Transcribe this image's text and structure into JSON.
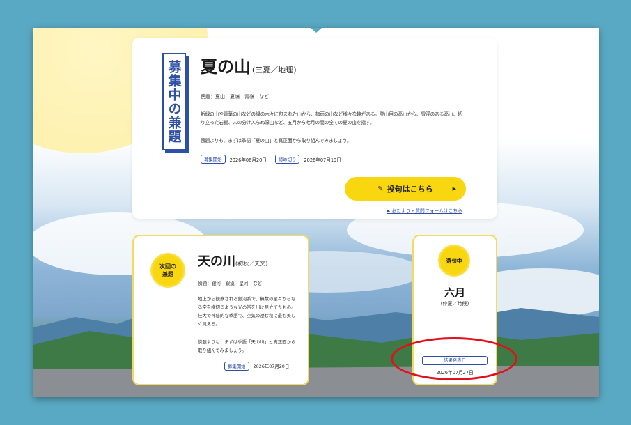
{
  "main": {
    "vertical_label": "募集中の兼題",
    "title": "夏の山",
    "subtitle": "(三夏／地理)",
    "side_names": "傍題：夏山　夏嶺　青嶺　など",
    "description": "新緑の山や青葉の山などの緑の木々に包まれた山から、梅雨の山など様々な趣がある。登山用の高山から、雪渓のある高山、切り立った岩棚、人の分け入らぬ深山など、五月から七月の間の全ての夏の山を指す。",
    "description2": "傍題よりも、まずは季語「夏の山」と真正面から取り組んでみましょう。",
    "start_label": "募集開始",
    "start_date": "2026年06月20日",
    "end_label": "締め切り",
    "end_date": "2026年07月19日",
    "post_button": "投句はこちら",
    "letter_link": "▶ おたより・質問フォームはこちら"
  },
  "next": {
    "badge": "次回の兼題",
    "title": "天の川",
    "subtitle": "(初秋／天文)",
    "side_names": "傍題：銀河　銀漢　星河　など",
    "description": "地上から観察される銀河系で、無数の星々からなる空を横切るような光の帯を川に見立てたもの。壮大で神秘的な季語で、空気の澄む秋に最も美しく見える。",
    "description2": "傍題よりも、まずは季語「天の川」と真正面から取り組んでみましょう。",
    "start_label": "募集開始",
    "start_date": "2026年07月20日"
  },
  "selection": {
    "badge": "選句中",
    "month": "六月",
    "subtitle": "(仲夏／時候)",
    "result_label": "結果発表日",
    "result_date": "2026年07月27日"
  },
  "colors": {
    "accent_yellow": "#f8d610",
    "accent_blue": "#2d4fa6",
    "annotation_red": "#e0101c",
    "backdrop": "#5aa9c4"
  }
}
